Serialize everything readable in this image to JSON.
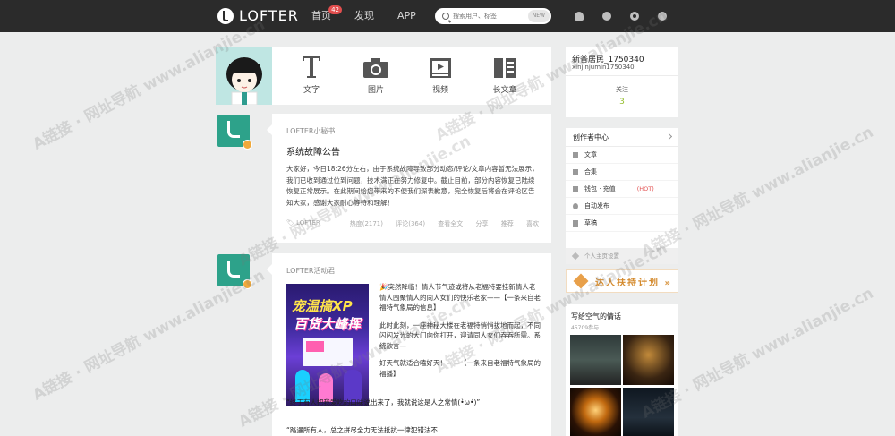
{
  "topbar": {
    "logo_text": "LOFTER",
    "nav": [
      {
        "label": "首页",
        "badge": "42"
      },
      {
        "label": "发现"
      },
      {
        "label": "APP"
      }
    ],
    "search_placeholder": "搜索用户、标签",
    "search_new": "NEW",
    "icons": [
      "bell-icon",
      "message-icon",
      "settings-icon",
      "more-icon"
    ]
  },
  "publish": {
    "items": [
      {
        "icon": "text-icon",
        "label": "文字"
      },
      {
        "icon": "camera-icon",
        "label": "图片"
      },
      {
        "icon": "video-icon",
        "label": "视频"
      },
      {
        "icon": "article-icon",
        "label": "长文章"
      }
    ]
  },
  "posts": [
    {
      "author": "LOFTER小秘书",
      "title": "系统故障公告",
      "body": "大家好，今日18:26分左右，由于系统故障导致部分动态/评论/文章内容暂无法展示，我们已收到通过位到问题，技术满正在努力修复中。截止目前，部分内容恢复已陆续恢复正常展示。在此期间给您带来的不便我们深表歉意，完全恢复后将会在评论区告知大家，感谢大家耐心等待和理解！",
      "tag": "LOFTER",
      "actions": [
        "热度(2171)",
        "评论(364)",
        "查看全文",
        "分享",
        "推荐",
        "喜欢"
      ]
    },
    {
      "author": "LOFTER活动君",
      "poster_line1": "宠温搞XP",
      "poster_line2": "百货大峰挥",
      "paragraphs": [
        "🎉突然降临！情人节气迹或将从老福特要挂新情人老情人围聚情人的同人女们的快乐老家——【一条来自老福特气象局的信息】",
        "此时此刻，一座神秘大楼在老福特悄悄拔地而起，不同闪闪发光的大门向你打开，迎请同人女们吞吞所需。系统欲言—",
        "好天气就适合嗑好天！——【一条来自老福特气象局的福播】"
      ],
      "quote": "“终于有人把我爱吃的口味说出来了，我就说这是人之常情(•̀ω•́)”",
      "quote2": "“路遇所有人，总之拼尽全力无法抵抗一律犯错法不..."
    }
  ],
  "profile": {
    "name": "新普居民_1750340",
    "uid": "xinjinjumin1750340",
    "follow_label": "关注",
    "follow_count": "3"
  },
  "creator_menu": {
    "header": "创作者中心",
    "items": [
      {
        "label": "文章"
      },
      {
        "label": "合集"
      },
      {
        "label": "钱包 · 充值",
        "hot": "(HOT)"
      },
      {
        "label": "自动发布"
      },
      {
        "label": "草稿"
      }
    ],
    "footer": "个人主页设置"
  },
  "promo": {
    "text": "达人扶持计划 »"
  },
  "tag_box": {
    "title": "写给空气的情话",
    "subtitle": "45709参与"
  },
  "watermark": "A链接 · 网址导航  www.alianjie.cn"
}
